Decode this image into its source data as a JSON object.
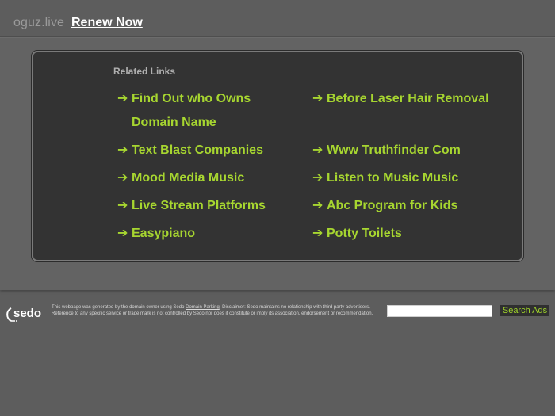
{
  "header": {
    "domain": "oguz.live",
    "renew_label": "Renew Now"
  },
  "related": {
    "title": "Related Links",
    "arrow": "➔",
    "left": [
      {
        "label": "Find Out who Owns Domain Name"
      },
      {
        "label": "Text Blast Companies"
      },
      {
        "label": "Mood Media Music"
      },
      {
        "label": "Live Stream Platforms"
      },
      {
        "label": "Easypiano"
      }
    ],
    "right": [
      {
        "label": "Before Laser Hair Removal"
      },
      {
        "label": "Www Truthfinder Com"
      },
      {
        "label": "Listen to Music Music"
      },
      {
        "label": "Abc Program for Kids"
      },
      {
        "label": "Potty Toilets"
      }
    ]
  },
  "footer": {
    "logo_text": "sedo",
    "disclaimer_pre": "This webpage was generated by the domain owner using Sedo ",
    "disclaimer_link": "Domain Parking",
    "disclaimer_post": ". Disclaimer: Sedo maintains no relationship with third party advertisers. Reference to any specific service or trade mark is not controlled by Sedo nor does it constitute or imply its association, endorsement or recommendation.",
    "search_placeholder": "",
    "search_button": "Search Ads"
  },
  "colors": {
    "background": "#5d5d5d",
    "panel": "#333333",
    "link": "#a7d630",
    "accent_button_text": "#9fd42a"
  }
}
